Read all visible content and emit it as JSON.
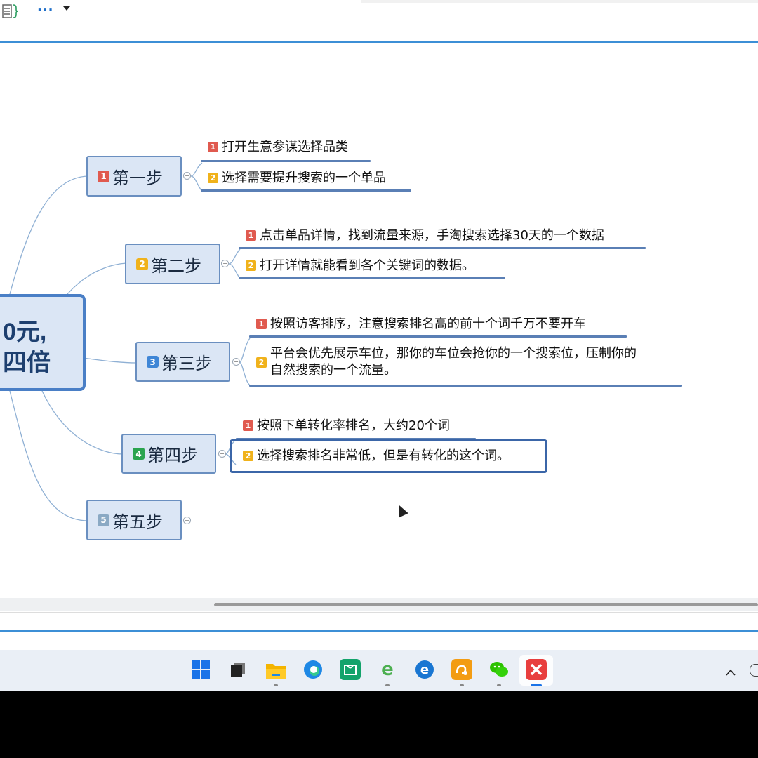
{
  "toolbar": {
    "more_label": "···"
  },
  "central": {
    "line1": "0元,",
    "line2": "四倍"
  },
  "branches": [
    {
      "num": "1",
      "badge_color": "#e05a4f",
      "label": "第一步",
      "leaves": [
        {
          "num": "1",
          "badge_color": "#e05a4f",
          "text": "打开生意参谋选择品类"
        },
        {
          "num": "2",
          "badge_color": "#f0b21b",
          "text": "选择需要提升搜索的一个单品"
        }
      ]
    },
    {
      "num": "2",
      "badge_color": "#f0b21b",
      "label": "第二步",
      "leaves": [
        {
          "num": "1",
          "badge_color": "#e05a4f",
          "text": "点击单品详情，找到流量来源，手淘搜索选择30天的一个数据"
        },
        {
          "num": "2",
          "badge_color": "#f0b21b",
          "text": "打开详情就能看到各个关键词的数据。"
        }
      ]
    },
    {
      "num": "3",
      "badge_color": "#3f86d6",
      "label": "第三步",
      "leaves": [
        {
          "num": "1",
          "badge_color": "#e05a4f",
          "text": "按照访客排序，注意搜索排名高的前十个词千万不要开车"
        },
        {
          "num": "2",
          "badge_color": "#f0b21b",
          "text": "平台会优先展示车位，那你的车位会抢你的一个搜索位，压制你的",
          "text2": "自然搜索的一个流量。"
        }
      ]
    },
    {
      "num": "4",
      "badge_color": "#2aa44f",
      "label": "第四步",
      "leaves": [
        {
          "num": "1",
          "badge_color": "#e05a4f",
          "text": "按照下单转化率排名，大约20个词"
        },
        {
          "num": "2",
          "badge_color": "#f0b21b",
          "text": "选择搜索排名非常低，但是有转化的这个词。"
        }
      ]
    },
    {
      "num": "5",
      "badge_color": "#8aa9c4",
      "label": "第五步",
      "leaves": []
    }
  ],
  "taskbar": {
    "icons": [
      "windows-start",
      "task-view",
      "file-explorer",
      "edge-browser",
      "store",
      "ie-browser",
      "edge-legacy",
      "uc-browser",
      "wechat",
      "xmind"
    ]
  }
}
